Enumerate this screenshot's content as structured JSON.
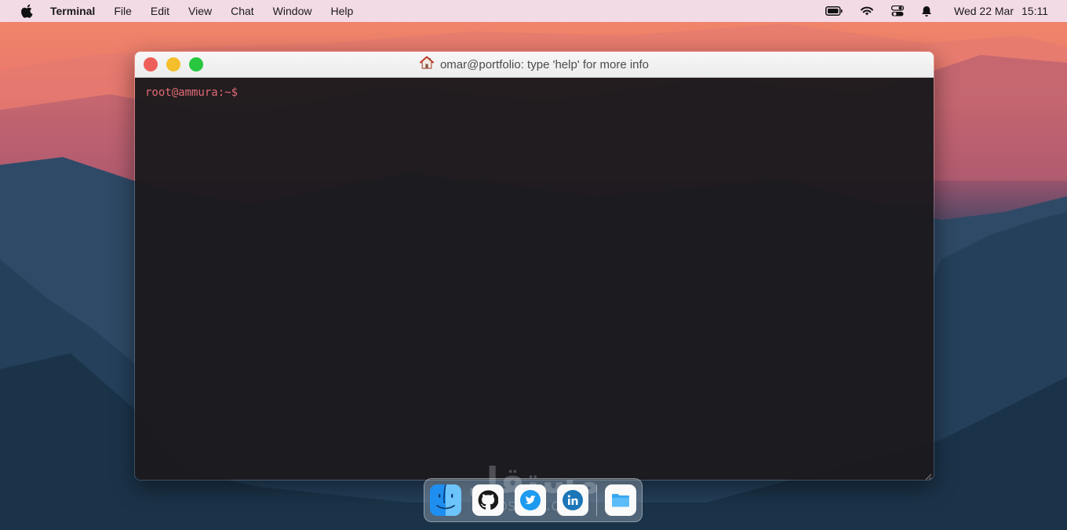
{
  "menubar": {
    "app_name": "Terminal",
    "menus": [
      "File",
      "Edit",
      "View",
      "Chat",
      "Window",
      "Help"
    ],
    "status_icons": [
      "battery-icon",
      "wifi-icon",
      "control-center-icon",
      "notification-bell-icon"
    ],
    "date": "Wed 22 Mar",
    "time": "15:11"
  },
  "terminal": {
    "title": "omar@portfolio: type 'help' for more info",
    "title_icon": "home-icon",
    "prompt": "root@ammura:~$",
    "colors": {
      "prompt": "#e06b74",
      "close": "#ee5f59",
      "minimize": "#f5bf2c",
      "maximize": "#28c73f"
    }
  },
  "dock": {
    "items": [
      "finder-icon",
      "github-icon",
      "twitter-icon",
      "linkedin-icon",
      "folder-icon"
    ]
  },
  "watermark": {
    "text": "مستقل",
    "sub": "mostaql.com"
  }
}
